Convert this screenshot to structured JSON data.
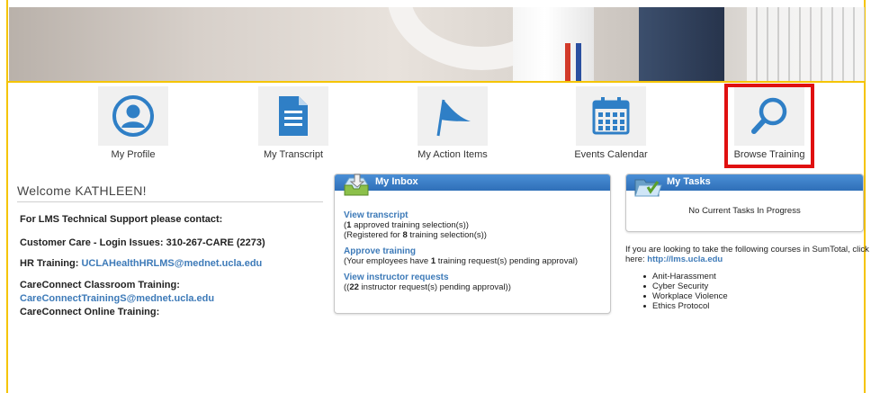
{
  "nav": {
    "profile_label": "My Profile",
    "transcript_label": "My Transcript",
    "action_items_label": "My Action Items",
    "events_label": "Events Calendar",
    "browse_label": "Browse Training"
  },
  "welcome": {
    "title": "Welcome KATHLEEN!",
    "support_text": "For LMS Technical Support please contact:",
    "customer_care": "Customer Care - Login Issues: 310-267-CARE (2273)",
    "hr_label": "HR Training: ",
    "hr_email": "UCLAHealthHRLMS@mednet.ucla.edu",
    "classroom_label": "CareConnect Classroom Training:",
    "classroom_email": "CareConnectTrainingS@mednet.ucla.edu",
    "online_label": "CareConnect Online Training:"
  },
  "inbox": {
    "title": "My Inbox",
    "view_transcript": "View transcript",
    "approved_count": "1",
    "approved_rest": " approved training selection(s))",
    "registered_pre": "(Registered for ",
    "registered_count": "8",
    "registered_rest": " training selection(s))",
    "approve_training": "Approve training",
    "employees_pre": "(Your employees have ",
    "employees_count": "1",
    "employees_rest": " training request(s) pending approval)",
    "view_instructor": "View instructor requests",
    "instructor_pre": "((",
    "instructor_count": "22",
    "instructor_rest": " instructor request(s) pending approval))"
  },
  "tasks": {
    "title": "My Tasks",
    "empty_text": "No Current Tasks In Progress",
    "intro": "If you are looking to take the following courses in SumTotal, click",
    "here_label": "here: ",
    "url": "http://lms.ucla.edu",
    "courses": [
      "Anit-Harassment",
      "Cyber Security",
      "Workplace Violence",
      "Ethics Protocol"
    ]
  },
  "colors": {
    "accent_blue": "#2f7fc6",
    "highlight_red": "#e01010",
    "frame_yellow": "#f5c400",
    "link_blue": "#3d7ab8"
  }
}
